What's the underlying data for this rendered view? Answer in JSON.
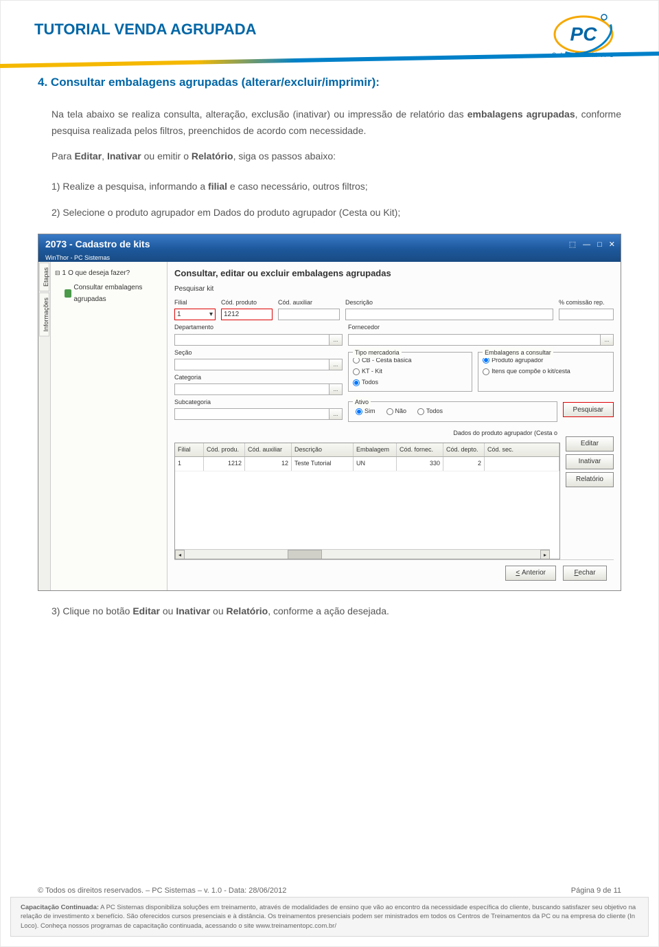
{
  "header": {
    "title": "TUTORIAL VENDA AGRUPADA",
    "logo_brand": "PC",
    "logo_sub": "S I S T E M A S"
  },
  "section": {
    "number": "4.",
    "title": "Consultar embalagens agrupadas (alterar/excluir/imprimir):"
  },
  "para1_a": "Na tela abaixo se realiza consulta, alteração, exclusão (inativar) ou impressão de relatório das ",
  "para1_b": "embalagens agrupadas",
  "para1_c": ", conforme pesquisa realizada pelos filtros, preenchidos de acordo com necessidade.",
  "para2_a": "Para ",
  "para2_b": "Editar",
  "para2_c": ", ",
  "para2_d": "Inativar",
  "para2_e": " ou emitir o ",
  "para2_f": "Relatório",
  "para2_g": ", siga os passos abaixo:",
  "step1_a": "1) Realize a pesquisa, informando a ",
  "step1_b": "filial",
  "step1_c": " e caso necessário, outros filtros;",
  "step2": "2) Selecione o produto agrupador em Dados do produto agrupador (Cesta ou Kit);",
  "step3_a": "3) Clique no botão ",
  "step3_b": "Editar",
  "step3_c": " ou ",
  "step3_d": "Inativar",
  "step3_e": " ou ",
  "step3_f": "Relatório",
  "step3_g": ", conforme a ação desejada.",
  "screenshot": {
    "window_title": "2073 - Cadastro de kits",
    "window_sub": "WinThor - PC Sistemas",
    "vtab1": "Etapas",
    "vtab2": "Informações",
    "tree_num": "1",
    "tree1": "O que deseja fazer?",
    "tree2": "Consultar embalagens agrupadas",
    "main_heading": "Consultar, editar ou excluir embalagens agrupadas",
    "sub_heading": "Pesquisar kit",
    "labels": {
      "filial": "Filial",
      "cod_produto": "Cód. produto",
      "cod_auxiliar": "Cód. auxiliar",
      "descricao": "Descrição",
      "comissao": "% comissão rep.",
      "departamento": "Departamento",
      "fornecedor": "Fornecedor",
      "secao": "Seção",
      "categoria": "Categoria",
      "subcategoria": "Subcategoria",
      "tipo_merc": "Tipo mercadoria",
      "emb_consultar": "Embalagens a consultar",
      "ativo": "Ativo"
    },
    "values": {
      "filial": "1",
      "cod_produto": "1212"
    },
    "radios": {
      "cb": "CB - Cesta básica",
      "kt": "KT - Kit",
      "todos": "Todos",
      "prod_agrup": "Produto agrupador",
      "itens": "Itens que compõe o kit/cesta",
      "sim": "Sim",
      "nao": "Não"
    },
    "buttons": {
      "pesquisar": "Pesquisar",
      "editar": "Editar",
      "inativar": "Inativar",
      "relatorio": "Relatório",
      "anterior": "< Anterior",
      "fechar": "Fechar",
      "lookup": "..."
    },
    "grid_caption": "Dados do produto agrupador (Cesta o",
    "grid_headers": [
      "Filial",
      "Cód. produ.",
      "Cód. auxiliar",
      "Descrição",
      "Embalagem",
      "Cód. fornec.",
      "Cód. depto.",
      "Cód. sec."
    ],
    "grid_row": [
      "1",
      "1212",
      "12",
      "Teste Tutorial",
      "UN",
      "330",
      "2",
      ""
    ]
  },
  "footer": {
    "copyright": "© Todos os direitos reservados. – PC Sistemas – v. 1.0 - Data: 28/06/2012",
    "page": "Página 9 de 11",
    "caption_title": "Capacitação Continuada:",
    "caption": " A PC Sistemas disponibiliza soluções em treinamento, através de modalidades de ensino que vão ao encontro da necessidade específica do cliente, buscando satisfazer seu objetivo na relação de investimento x benefício. São oferecidos cursos presenciais e à distância. Os treinamentos presenciais podem ser ministrados em todos os Centros de Treinamentos da PC ou na empresa do cliente (In Loco). Conheça nossos programas de capacitação continuada, acessando o site www.treinamentopc.com.br/"
  }
}
